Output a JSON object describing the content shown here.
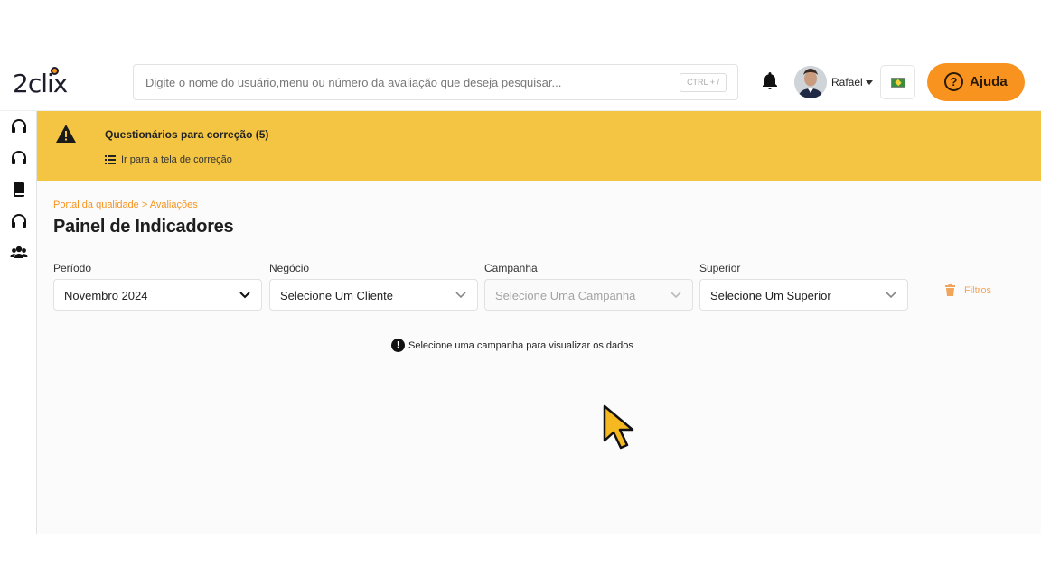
{
  "app": {
    "logo_text": "2clix"
  },
  "header": {
    "search_placeholder": "Digite o nome do usuário,menu ou número da avaliação que deseja pesquisar...",
    "shortcut": "CTRL + /",
    "user_name": "Rafael",
    "help_label": "Ajuda",
    "help_icon": "?",
    "accent": "#f7931e"
  },
  "sidebar": {
    "items": [
      {
        "icon": "headset-icon"
      },
      {
        "icon": "headset-icon"
      },
      {
        "icon": "book-icon"
      },
      {
        "icon": "headset-icon"
      },
      {
        "icon": "users-icon"
      }
    ]
  },
  "alert": {
    "title": "Questionários para correção (5)",
    "link": "Ir para a tela de correção",
    "background": "#f4c542"
  },
  "main": {
    "breadcrumb": "Portal da qualidade > Avaliações",
    "title": "Painel de Indicadores",
    "filters": [
      {
        "label": "Período",
        "value": "Novembro 2024",
        "disabled": false
      },
      {
        "label": "Negócio",
        "value": "Selecione Um Cliente",
        "disabled": false
      },
      {
        "label": "Campanha",
        "value": "Selecione Uma Campanha",
        "disabled": true
      },
      {
        "label": "Superior",
        "value": "Selecione Um Superior",
        "disabled": false
      }
    ],
    "filters_button": "Filtros",
    "info_icon": "!",
    "info_message": "Selecione uma campanha para visualizar os dados"
  }
}
